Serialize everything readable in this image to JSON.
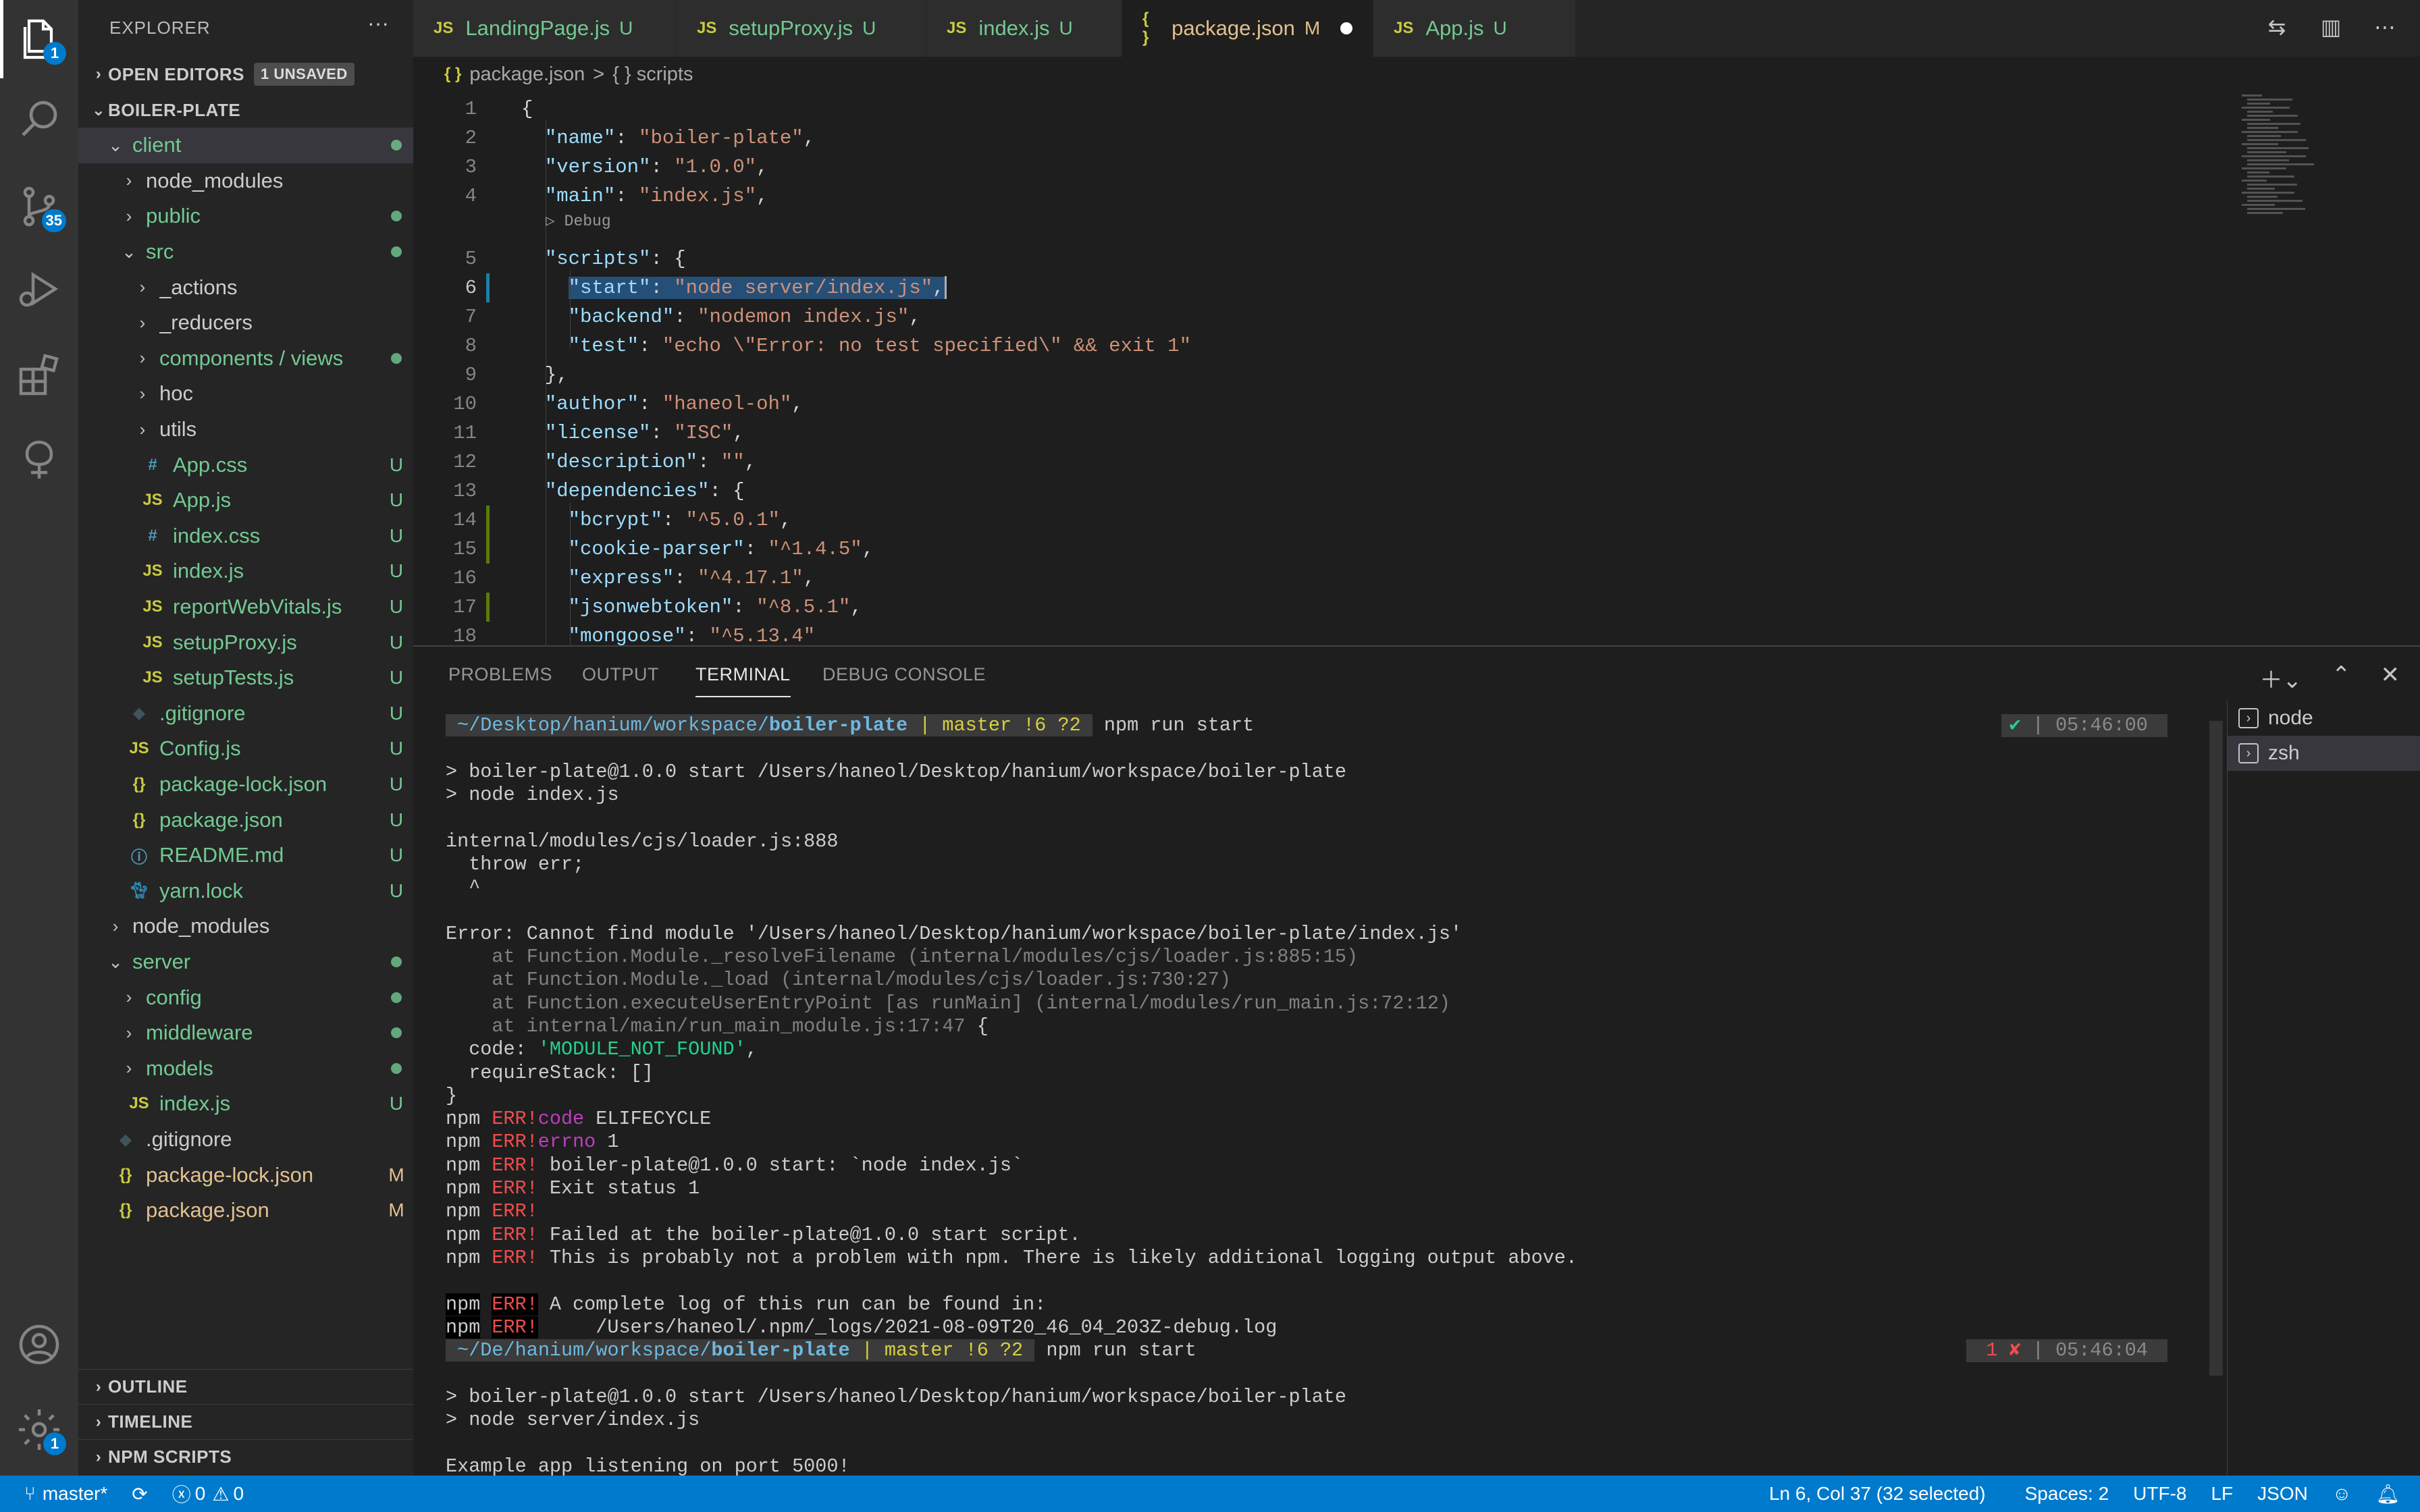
{
  "activity_bar": {
    "items": [
      {
        "name": "explorer",
        "badge": "1"
      },
      {
        "name": "search",
        "badge": ""
      },
      {
        "name": "source-control",
        "badge": "35"
      },
      {
        "name": "run-debug",
        "badge": ""
      },
      {
        "name": "extensions",
        "badge": ""
      },
      {
        "name": "remote",
        "badge": ""
      }
    ],
    "accounts_badge": "",
    "settings_badge": "1"
  },
  "sidebar": {
    "title": "EXPLORER",
    "more": "···",
    "open_editors": {
      "label": "OPEN EDITORS",
      "badge": "1 UNSAVED"
    },
    "project": "BOILER-PLATE",
    "tree": [
      {
        "indent": 1,
        "type": "folder",
        "open": true,
        "label": "client",
        "stat": "dot",
        "color": "green",
        "selected": true
      },
      {
        "indent": 2,
        "type": "folder",
        "open": false,
        "label": "node_modules",
        "stat": "",
        "color": "plain"
      },
      {
        "indent": 2,
        "type": "folder",
        "open": false,
        "label": "public",
        "stat": "dot",
        "color": "green"
      },
      {
        "indent": 2,
        "type": "folder",
        "open": true,
        "label": "src",
        "stat": "dot",
        "color": "green"
      },
      {
        "indent": 3,
        "type": "folder",
        "open": false,
        "label": "_actions",
        "stat": "",
        "color": "plain"
      },
      {
        "indent": 3,
        "type": "folder",
        "open": false,
        "label": "_reducers",
        "stat": "",
        "color": "plain"
      },
      {
        "indent": 3,
        "type": "folder",
        "open": false,
        "label": "components / views",
        "stat": "dot",
        "color": "green"
      },
      {
        "indent": 3,
        "type": "folder",
        "open": false,
        "label": "hoc",
        "stat": "",
        "color": "plain"
      },
      {
        "indent": 3,
        "type": "folder",
        "open": false,
        "label": "utils",
        "stat": "",
        "color": "plain"
      },
      {
        "indent": 3,
        "type": "css",
        "label": "App.css",
        "stat": "U",
        "color": "green"
      },
      {
        "indent": 3,
        "type": "js",
        "label": "App.js",
        "stat": "U",
        "color": "green"
      },
      {
        "indent": 3,
        "type": "css",
        "label": "index.css",
        "stat": "U",
        "color": "green"
      },
      {
        "indent": 3,
        "type": "js",
        "label": "index.js",
        "stat": "U",
        "color": "green"
      },
      {
        "indent": 3,
        "type": "js",
        "label": "reportWebVitals.js",
        "stat": "U",
        "color": "green"
      },
      {
        "indent": 3,
        "type": "js",
        "label": "setupProxy.js",
        "stat": "U",
        "color": "green"
      },
      {
        "indent": 3,
        "type": "js",
        "label": "setupTests.js",
        "stat": "U",
        "color": "green"
      },
      {
        "indent": 2,
        "type": "git",
        "label": ".gitignore",
        "stat": "U",
        "color": "green"
      },
      {
        "indent": 2,
        "type": "js",
        "label": "Config.js",
        "stat": "U",
        "color": "green"
      },
      {
        "indent": 2,
        "type": "json",
        "label": "package-lock.json",
        "stat": "U",
        "color": "green"
      },
      {
        "indent": 2,
        "type": "json",
        "label": "package.json",
        "stat": "U",
        "color": "green"
      },
      {
        "indent": 2,
        "type": "info",
        "label": "README.md",
        "stat": "U",
        "color": "green"
      },
      {
        "indent": 2,
        "type": "yarn",
        "label": "yarn.lock",
        "stat": "U",
        "color": "green"
      },
      {
        "indent": 1,
        "type": "folder",
        "open": false,
        "label": "node_modules",
        "stat": "",
        "color": "plain"
      },
      {
        "indent": 1,
        "type": "folder",
        "open": true,
        "label": "server",
        "stat": "dot",
        "color": "green"
      },
      {
        "indent": 2,
        "type": "folder",
        "open": false,
        "label": "config",
        "stat": "dot",
        "color": "green"
      },
      {
        "indent": 2,
        "type": "folder",
        "open": false,
        "label": "middleware",
        "stat": "dot",
        "color": "green"
      },
      {
        "indent": 2,
        "type": "folder",
        "open": false,
        "label": "models",
        "stat": "dot",
        "color": "green"
      },
      {
        "indent": 2,
        "type": "js",
        "label": "index.js",
        "stat": "U",
        "color": "green"
      },
      {
        "indent": 1,
        "type": "git",
        "label": ".gitignore",
        "stat": "",
        "color": "plain"
      },
      {
        "indent": 1,
        "type": "json",
        "label": "package-lock.json",
        "stat": "M",
        "color": "mod"
      },
      {
        "indent": 1,
        "type": "json",
        "label": "package.json",
        "stat": "M",
        "color": "mod"
      }
    ],
    "bottom_sections": [
      "OUTLINE",
      "TIMELINE",
      "NPM SCRIPTS"
    ]
  },
  "tabs": [
    {
      "label": "LandingPage.js",
      "status": "U",
      "active": false,
      "dirty": false
    },
    {
      "label": "setupProxy.js",
      "status": "U",
      "active": false,
      "dirty": false
    },
    {
      "label": "index.js",
      "status": "U",
      "active": false,
      "dirty": false
    },
    {
      "label": "package.json",
      "status": "M",
      "active": true,
      "dirty": true
    },
    {
      "label": "App.js",
      "status": "U",
      "active": false,
      "dirty": false
    }
  ],
  "breadcrumb": {
    "file": "package.json",
    "sep": ">",
    "symbol": "{ } scripts"
  },
  "editor": {
    "code_lens": "▷ Debug",
    "lines": [
      {
        "n": "1",
        "parts": [
          [
            "p",
            "{"
          ]
        ]
      },
      {
        "n": "2",
        "parts": [
          [
            "p",
            "  "
          ],
          [
            "k",
            "\"name\""
          ],
          [
            "p",
            ": "
          ],
          [
            "s",
            "\"boiler-plate\""
          ],
          [
            "p",
            ","
          ]
        ]
      },
      {
        "n": "3",
        "parts": [
          [
            "p",
            "  "
          ],
          [
            "k",
            "\"version\""
          ],
          [
            "p",
            ": "
          ],
          [
            "s",
            "\"1.0.0\""
          ],
          [
            "p",
            ","
          ]
        ]
      },
      {
        "n": "4",
        "parts": [
          [
            "p",
            "  "
          ],
          [
            "k",
            "\"main\""
          ],
          [
            "p",
            ": "
          ],
          [
            "s",
            "\"index.js\""
          ],
          [
            "p",
            ","
          ]
        ]
      },
      {
        "n": "5",
        "parts": [
          [
            "p",
            "  "
          ],
          [
            "k",
            "\"scripts\""
          ],
          [
            "p",
            ": {"
          ]
        ]
      },
      {
        "n": "6",
        "parts": [
          [
            "p",
            "    "
          ],
          [
            "ksel",
            "\"start\""
          ],
          [
            "psel",
            ": "
          ],
          [
            "ssel",
            "\"node server/index.js\""
          ],
          [
            "psel",
            ","
          ]
        ]
      },
      {
        "n": "7",
        "parts": [
          [
            "p",
            "    "
          ],
          [
            "k",
            "\"backend\""
          ],
          [
            "p",
            ": "
          ],
          [
            "s",
            "\"nodemon index.js\""
          ],
          [
            "p",
            ","
          ]
        ]
      },
      {
        "n": "8",
        "parts": [
          [
            "p",
            "    "
          ],
          [
            "k",
            "\"test\""
          ],
          [
            "p",
            ": "
          ],
          [
            "s",
            "\"echo \\\"Error: no test specified\\\" && exit 1\""
          ]
        ]
      },
      {
        "n": "9",
        "parts": [
          [
            "p",
            "  },"
          ]
        ]
      },
      {
        "n": "10",
        "parts": [
          [
            "p",
            "  "
          ],
          [
            "k",
            "\"author\""
          ],
          [
            "p",
            ": "
          ],
          [
            "s",
            "\"haneol-oh\""
          ],
          [
            "p",
            ","
          ]
        ]
      },
      {
        "n": "11",
        "parts": [
          [
            "p",
            "  "
          ],
          [
            "k",
            "\"license\""
          ],
          [
            "p",
            ": "
          ],
          [
            "s",
            "\"ISC\""
          ],
          [
            "p",
            ","
          ]
        ]
      },
      {
        "n": "12",
        "parts": [
          [
            "p",
            "  "
          ],
          [
            "k",
            "\"description\""
          ],
          [
            "p",
            ": "
          ],
          [
            "s",
            "\"\""
          ],
          [
            "p",
            ","
          ]
        ]
      },
      {
        "n": "13",
        "parts": [
          [
            "p",
            "  "
          ],
          [
            "k",
            "\"dependencies\""
          ],
          [
            "p",
            ": {"
          ]
        ]
      },
      {
        "n": "14",
        "parts": [
          [
            "p",
            "    "
          ],
          [
            "k",
            "\"bcrypt\""
          ],
          [
            "p",
            ": "
          ],
          [
            "s",
            "\"^5.0.1\""
          ],
          [
            "p",
            ","
          ]
        ]
      },
      {
        "n": "15",
        "parts": [
          [
            "p",
            "    "
          ],
          [
            "k",
            "\"cookie-parser\""
          ],
          [
            "p",
            ": "
          ],
          [
            "s",
            "\"^1.4.5\""
          ],
          [
            "p",
            ","
          ]
        ]
      },
      {
        "n": "16",
        "parts": [
          [
            "p",
            "    "
          ],
          [
            "k",
            "\"express\""
          ],
          [
            "p",
            ": "
          ],
          [
            "s",
            "\"^4.17.1\""
          ],
          [
            "p",
            ","
          ]
        ]
      },
      {
        "n": "17",
        "parts": [
          [
            "p",
            "    "
          ],
          [
            "k",
            "\"jsonwebtoken\""
          ],
          [
            "p",
            ": "
          ],
          [
            "s",
            "\"^8.5.1\""
          ],
          [
            "p",
            ","
          ]
        ]
      },
      {
        "n": "18",
        "parts": [
          [
            "p",
            "    "
          ],
          [
            "k",
            "\"mongoose\""
          ],
          [
            "p",
            ": "
          ],
          [
            "s",
            "\"^5.13.4\""
          ]
        ]
      }
    ]
  },
  "panel": {
    "tabs": [
      "PROBLEMS",
      "OUTPUT",
      "TERMINAL",
      "DEBUG CONSOLE"
    ],
    "active_tab": "TERMINAL",
    "terminals": [
      "node",
      "zsh"
    ],
    "terminal_lines": [
      {
        "kind": "prompt",
        "path_pre": " ~/Desktop/hanium/workspace/",
        "path_bold": "boiler-plate",
        "git": " | master !6 ?2 ",
        "cmd": " npm run start",
        "right_mark": "✔",
        "right_time": " | 05:46:00 ",
        "right_bad": false
      },
      {
        "kind": "blank"
      },
      {
        "kind": "text",
        "text": "> boiler-plate@1.0.0 start /Users/haneol/Desktop/hanium/workspace/boiler-plate"
      },
      {
        "kind": "text",
        "text": "> node index.js"
      },
      {
        "kind": "blank"
      },
      {
        "kind": "text",
        "text": "internal/modules/cjs/loader.js:888"
      },
      {
        "kind": "text",
        "text": "  throw err;"
      },
      {
        "kind": "text",
        "text": "  ^"
      },
      {
        "kind": "blank"
      },
      {
        "kind": "text",
        "text": "Error: Cannot find module '/Users/haneol/Desktop/hanium/workspace/boiler-plate/index.js'"
      },
      {
        "kind": "dim",
        "text": "    at Function.Module._resolveFilename (internal/modules/cjs/loader.js:885:15)"
      },
      {
        "kind": "dim",
        "text": "    at Function.Module._load (internal/modules/cjs/loader.js:730:27)"
      },
      {
        "kind": "dim",
        "text": "    at Function.executeUserEntryPoint [as runMain] (internal/modules/run_main.js:72:12)"
      },
      {
        "kind": "dimend",
        "text": "    at internal/main/run_main_module.js:17:47",
        "tail": " {"
      },
      {
        "kind": "code",
        "pre": "  code: ",
        "val": "'MODULE_NOT_FOUND'",
        "post": ","
      },
      {
        "kind": "text",
        "text": "  requireStack: []"
      },
      {
        "kind": "text",
        "text": "}"
      },
      {
        "kind": "npm",
        "tag": "code",
        "text": " ELIFECYCLE",
        "mag": true
      },
      {
        "kind": "npm",
        "tag": "errno",
        "text": " 1",
        "mag": true
      },
      {
        "kind": "npm",
        "tag": "",
        "text": " boiler-plate@1.0.0 start: `node index.js`",
        "mag": false
      },
      {
        "kind": "npm",
        "tag": "",
        "text": " Exit status 1",
        "mag": false
      },
      {
        "kind": "npm",
        "tag": "",
        "text": "",
        "mag": false
      },
      {
        "kind": "npm",
        "tag": "",
        "text": " Failed at the boiler-plate@1.0.0 start script.",
        "mag": false
      },
      {
        "kind": "npm",
        "tag": "",
        "text": " This is probably not a problem with npm. There is likely additional logging output above.",
        "mag": false
      },
      {
        "kind": "blank"
      },
      {
        "kind": "npmb",
        "tag": "",
        "text": " A complete log of this run can be found in:",
        "mag": false
      },
      {
        "kind": "npmb",
        "tag": "",
        "text": "     /Users/haneol/.npm/_logs/2021-08-09T20_46_04_203Z-debug.log",
        "mag": false
      },
      {
        "kind": "prompt",
        "path_pre": " ~/De/hanium/workspace/",
        "path_bold": "boiler-plate",
        "git": " | master !6 ?2 ",
        "cmd": " npm run start",
        "right_mark": " 1 ✘",
        "right_time": " | 05:46:04 ",
        "right_bad": true
      },
      {
        "kind": "blank"
      },
      {
        "kind": "text",
        "text": "> boiler-plate@1.0.0 start /Users/haneol/Desktop/hanium/workspace/boiler-plate"
      },
      {
        "kind": "text",
        "text": "> node server/index.js"
      },
      {
        "kind": "blank"
      },
      {
        "kind": "text",
        "text": "Example app listening on port 5000!"
      }
    ],
    "npm_word": "npm",
    "err_word": "ERR!"
  },
  "statusbar": {
    "branch": "master*",
    "sync": "⟳",
    "errors": "0",
    "warnings": "0",
    "position": "Ln 6, Col 37 (32 selected)",
    "spaces": "Spaces: 2",
    "encoding": "UTF-8",
    "eol": "LF",
    "language": "JSON"
  }
}
